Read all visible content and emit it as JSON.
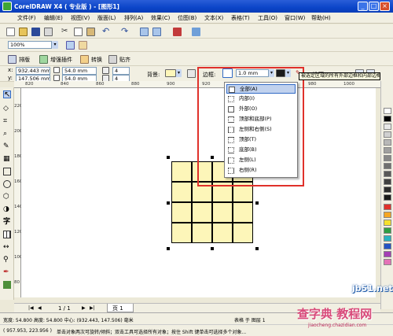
{
  "window": {
    "title": "CorelDRAW X4 ( 专业版 ) - [图形1]",
    "min_label": "_",
    "max_label": "□",
    "close_label": "×"
  },
  "menu": {
    "items": [
      "文件(F)",
      "编辑(E)",
      "视图(V)",
      "版面(L)",
      "排列(A)",
      "效果(C)",
      "位图(B)",
      "文本(X)",
      "表格(T)",
      "工具(O)",
      "窗口(W)",
      "帮助(H)"
    ]
  },
  "standard_toolbar": {
    "zoom_value": "100%"
  },
  "table_toolbar": {
    "layout_label": "排版",
    "increase_label": "增强插件",
    "convert_label": "转换",
    "paste_label": "贴齐"
  },
  "property_bar": {
    "x_label": "x:",
    "x_value": "932.443 mm",
    "y_label": "y:",
    "y_value": "147.506 mm",
    "w_value": "54.0 mm",
    "h_value": "54.0 mm",
    "rows_value": "4",
    "cols_value": "4",
    "background_label": "背景:",
    "border_label": "边框:",
    "border_width": "1.0 mm",
    "options_label": "选项",
    "tooltip": "被选定区域的所有外部边框和内部边框"
  },
  "ruler": {
    "top_ticks": [
      "820",
      "840",
      "860",
      "880",
      "900",
      "920",
      "940",
      "960",
      "980",
      "1000"
    ],
    "left_ticks": [
      "220",
      "200",
      "180",
      "160",
      "140",
      "120",
      "100",
      "80"
    ]
  },
  "border_menu": {
    "items": [
      "全部(A)",
      "内部(I)",
      "外部(O)",
      "顶部和底部(P)",
      "左侧和右侧(S)",
      "顶部(T)",
      "底部(B)",
      "左侧(L)",
      "右侧(R)"
    ]
  },
  "page_nav": {
    "counter": "1 / 1",
    "page_tab": "页 1"
  },
  "status": {
    "size_text": "宽度: 54.800  高度: 54.800  中心: (932.443, 147.506)  毫米",
    "layer_text": "表格 于 图层 1",
    "coords": "( 957.953, 223.956 )",
    "hint": "单击对象两次可旋转/倾斜；双击工具可选择所有对象；按住 Shift 键单击可选择多个对象..."
  },
  "watermark": {
    "site": "jb51.net",
    "brand": "查字典 教程网",
    "url": "jiaocheng.chazidian.com"
  },
  "colors": {
    "title_bar": "#0b45c8",
    "highlight": "#e0312b",
    "table_fill": "#fdf6b9",
    "selection": "#c1d2ee"
  }
}
